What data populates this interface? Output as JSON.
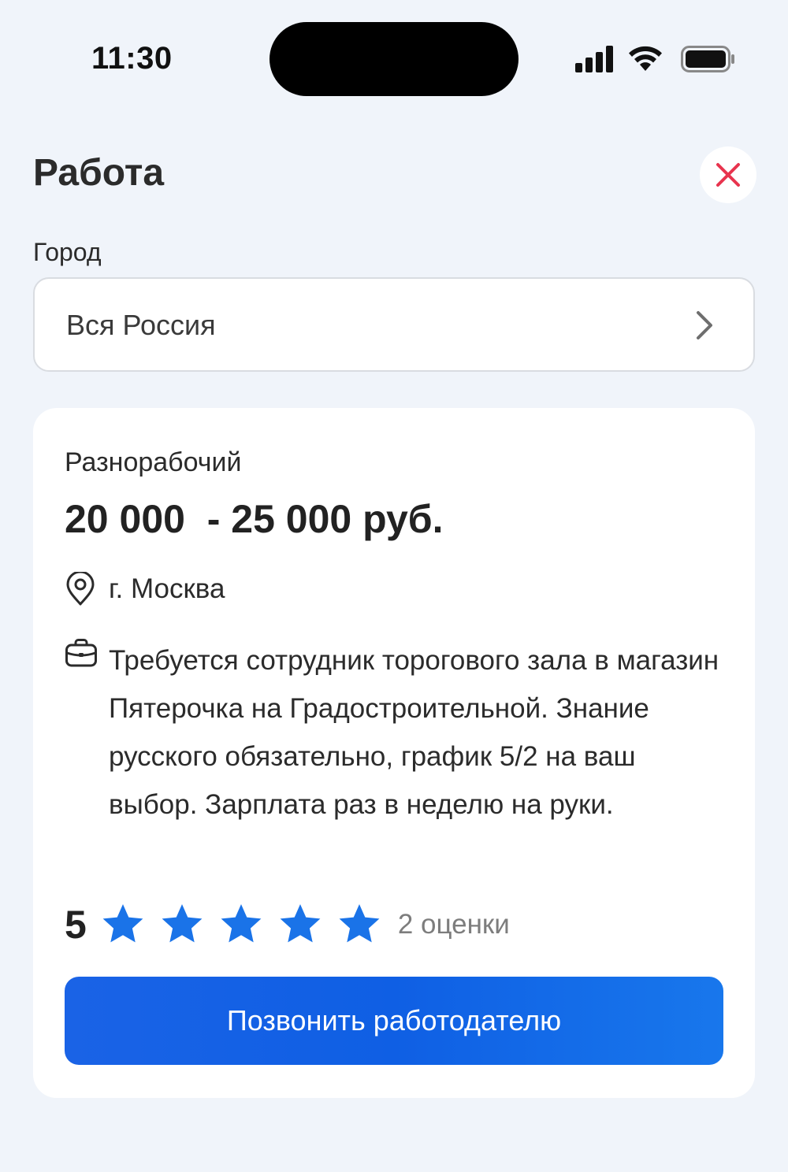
{
  "status_bar": {
    "time": "11:30"
  },
  "header": {
    "title": "Работа",
    "close_icon": "close-icon",
    "close_color": "#e8344e"
  },
  "city": {
    "label": "Город",
    "value": "Вся Россия",
    "icon": "chevron-right-icon"
  },
  "job": {
    "title": "Разнорабочий",
    "salary": "20 000  - 25 000 руб.",
    "location": "г. Москва",
    "description": "Требуется сотрудник торогового зала в магазин Пятерочка на Градостроительной. Знание русского обязательно, график 5/2 на ваш выбор. Зарплата раз в неделю на руки.",
    "rating": {
      "value": "5",
      "stars": 5,
      "max_stars": 5,
      "count_label": "2 оценки",
      "star_color": "#1a73e8"
    },
    "call_button": "Позвонить работодателю"
  },
  "colors": {
    "background": "#f0f4fa",
    "accent": "#1a63e6"
  }
}
